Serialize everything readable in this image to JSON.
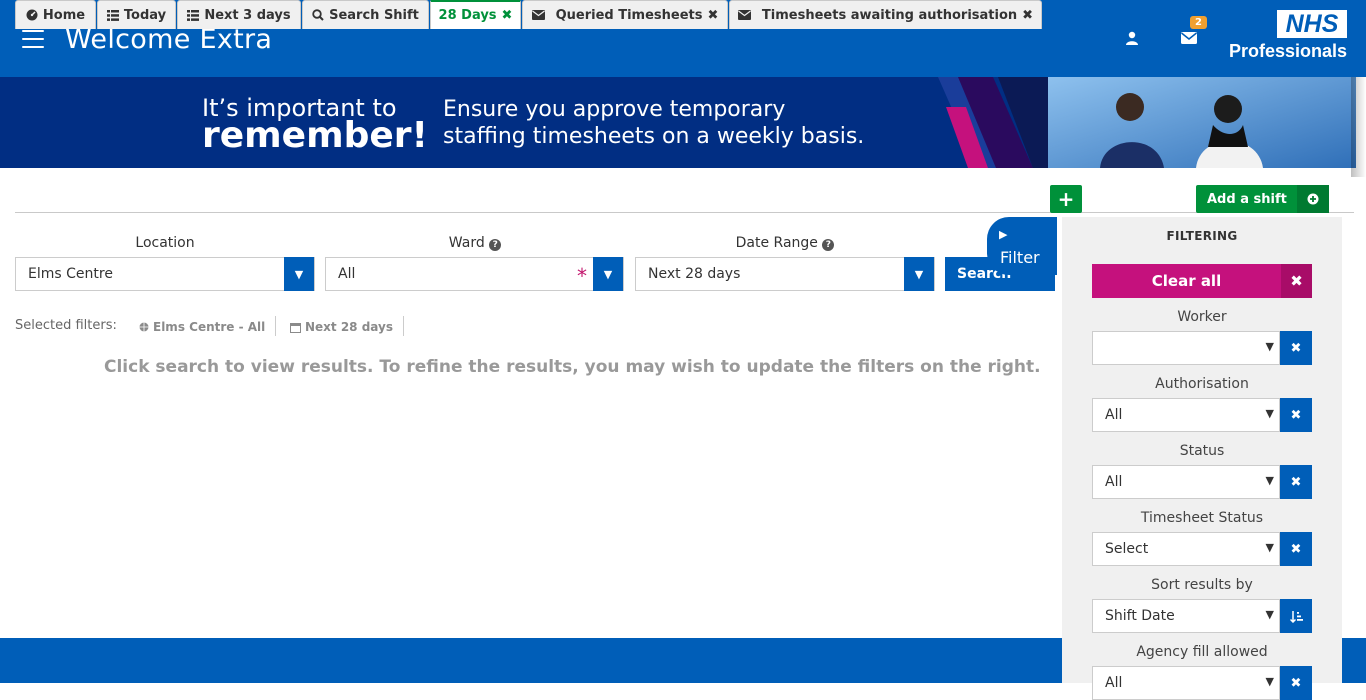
{
  "header": {
    "title": "Welcome Extra",
    "mail_badge": "2",
    "logo_text": "NHS",
    "logo_sub": "Professionals"
  },
  "banner": {
    "line1": "It’s important to",
    "line2": "remember!",
    "message1": "Ensure you approve temporary",
    "message2": "staffing timesheets on a weekly basis."
  },
  "tabs": [
    {
      "label": "Home",
      "icon": "dashboard-icon"
    },
    {
      "label": "Today",
      "icon": "list-icon"
    },
    {
      "label": "Next 3 days",
      "icon": "list-icon"
    },
    {
      "label": "Search Shift",
      "icon": "search-icon"
    },
    {
      "label": "28 Days",
      "icon": "",
      "active": true
    },
    {
      "label": "Queried Timesheets",
      "icon": "envelope-icon"
    },
    {
      "label": "Timesheets awaiting authorisation",
      "icon": "envelope-icon"
    }
  ],
  "add_shift_label": "Add a shift",
  "filters": {
    "location_label": "Location",
    "location_value": "Elms Centre",
    "ward_label": "Ward",
    "ward_value": "All",
    "date_label": "Date Range",
    "date_value": "Next 28 days",
    "search_label": "Search"
  },
  "selected": {
    "label": "Selected filters:",
    "chip1": "Elms Centre - All",
    "chip2": "Next 28 days"
  },
  "hint": "Click search to view results. To refine the results, you may wish to update the filters on the right.",
  "panel": {
    "tab_label": "Filter",
    "title": "FILTERING",
    "clear_all": "Clear all",
    "worker_label": "Worker",
    "worker_value": "",
    "authorisation_label": "Authorisation",
    "authorisation_value": "All",
    "status_label": "Status",
    "status_value": "All",
    "timesheet_status_label": "Timesheet Status",
    "timesheet_status_value": "Select",
    "sort_label": "Sort results by",
    "sort_value": "Shift Date",
    "agency_label": "Agency fill allowed",
    "agency_value": "All"
  },
  "colors": {
    "brand_blue": "#005eb8",
    "banner_navy": "#012e83",
    "green": "#00913a",
    "magenta": "#c5117d"
  }
}
